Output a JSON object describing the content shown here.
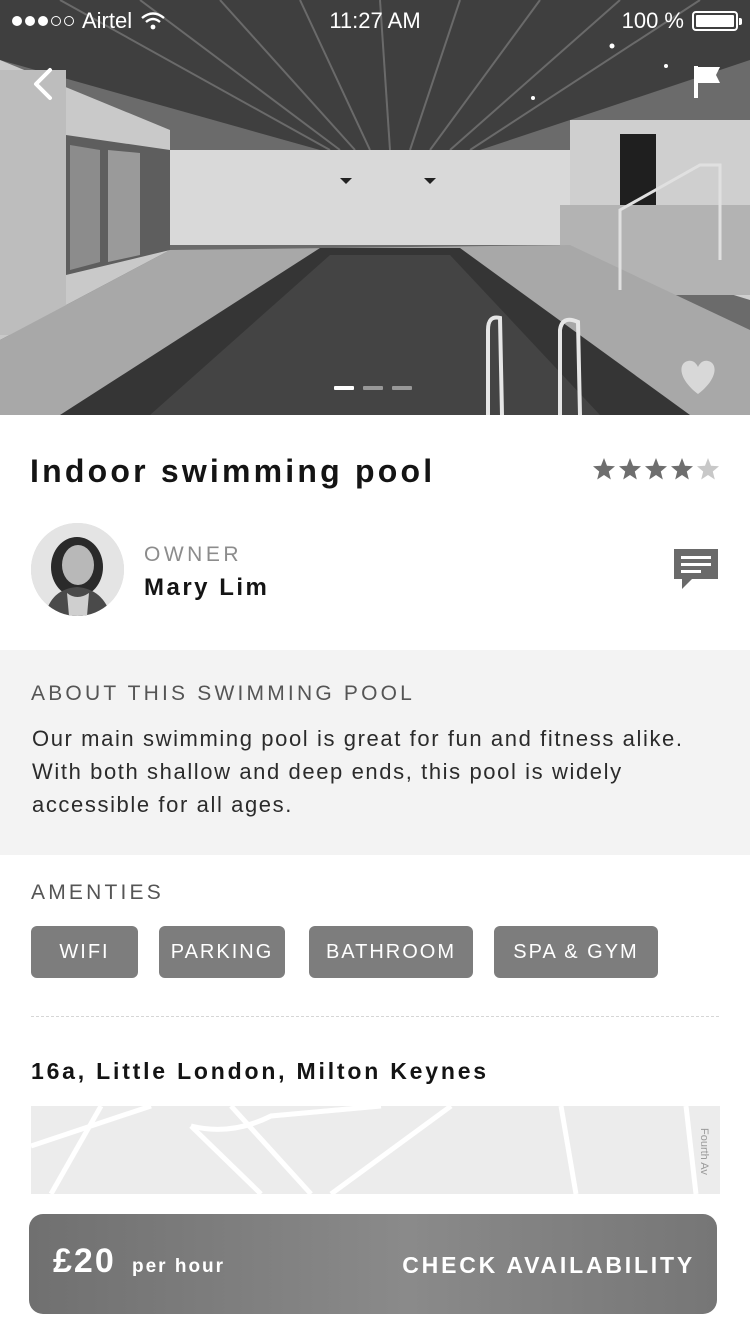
{
  "status": {
    "carrier": "Airtel",
    "time": "11:27 AM",
    "battery": "100 %"
  },
  "hero": {
    "slide_count": 3,
    "active_slide": 1
  },
  "listing": {
    "title": "Indoor swimming pool",
    "rating": 4,
    "rating_max": 5
  },
  "owner": {
    "label": "OWNER",
    "name": "Mary Lim"
  },
  "about": {
    "heading": "ABOUT THIS SWIMMING POOL",
    "text": "Our main swimming pool is great for fun and fitness alike. With both shallow and deep ends, this pool is widely accessible for all ages."
  },
  "amenities": {
    "heading": "AMENTIES",
    "items": [
      "WIFI",
      "PARKING",
      "BATHROOM",
      "SPA & GYM"
    ]
  },
  "location": {
    "address": "16a, Little London, Milton Keynes",
    "map_street_label": "Fourth Av"
  },
  "booking": {
    "price": "£20",
    "unit": "per hour",
    "cta": "CHECK AVAILABILITY"
  },
  "icons": {
    "back": "chevron-left-icon",
    "flag": "flag-icon",
    "favorite": "heart-icon",
    "star": "star-icon",
    "chat": "chat-bubble-icon",
    "wifi": "wifi-icon",
    "battery": "battery-icon"
  },
  "colors": {
    "chip_bg": "#7d7d7d",
    "about_bg": "#f3f3f3",
    "star_filled": "#6e6e6e",
    "star_empty": "#c8c8c8",
    "cta_bg": "#7e7e7e"
  }
}
